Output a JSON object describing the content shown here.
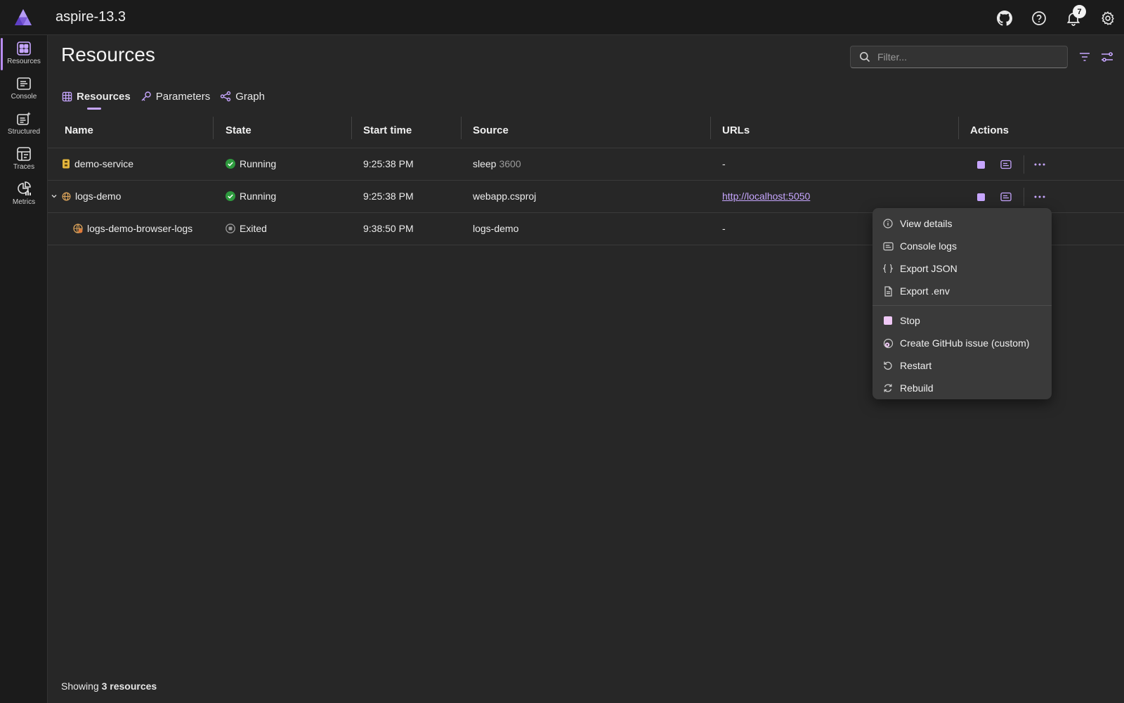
{
  "header": {
    "title": "aspire-13.3",
    "notification_count": "7"
  },
  "sidebar": {
    "items": [
      {
        "label": "Resources",
        "icon": "resources-grid-icon"
      },
      {
        "label": "Console",
        "icon": "console-icon"
      },
      {
        "label": "Structured",
        "icon": "structured-logs-icon"
      },
      {
        "label": "Traces",
        "icon": "traces-icon"
      },
      {
        "label": "Metrics",
        "icon": "metrics-icon"
      }
    ]
  },
  "page": {
    "title": "Resources",
    "filter_placeholder": "Filter..."
  },
  "tabs": [
    {
      "label": "Resources",
      "icon": "table-icon"
    },
    {
      "label": "Parameters",
      "icon": "key-icon"
    },
    {
      "label": "Graph",
      "icon": "graph-icon"
    }
  ],
  "table": {
    "columns": [
      "Name",
      "State",
      "Start time",
      "Source",
      "URLs",
      "Actions"
    ],
    "rows": [
      {
        "name": "demo-service",
        "state": "Running",
        "start": "9:25:38 PM",
        "source": "sleep",
        "source_extra": "3600",
        "url": "-"
      },
      {
        "name": "logs-demo",
        "state": "Running",
        "start": "9:25:38 PM",
        "source": "webapp.csproj",
        "source_extra": "",
        "url": "http://localhost:5050"
      },
      {
        "name": "logs-demo-browser-logs",
        "state": "Exited",
        "start": "9:38:50 PM",
        "source": "logs-demo",
        "source_extra": "",
        "url": "-"
      }
    ]
  },
  "context_menu": {
    "group1": [
      "View details",
      "Console logs",
      "Export JSON",
      "Export .env"
    ],
    "group2": [
      "Stop",
      "Create GitHub issue (custom)",
      "Restart",
      "Rebuild"
    ]
  },
  "footer": {
    "prefix": "Showing",
    "count": "3 resources"
  },
  "colors": {
    "accent": "#c7a6ff",
    "running": "#2e9a3e",
    "background": "#272727"
  }
}
